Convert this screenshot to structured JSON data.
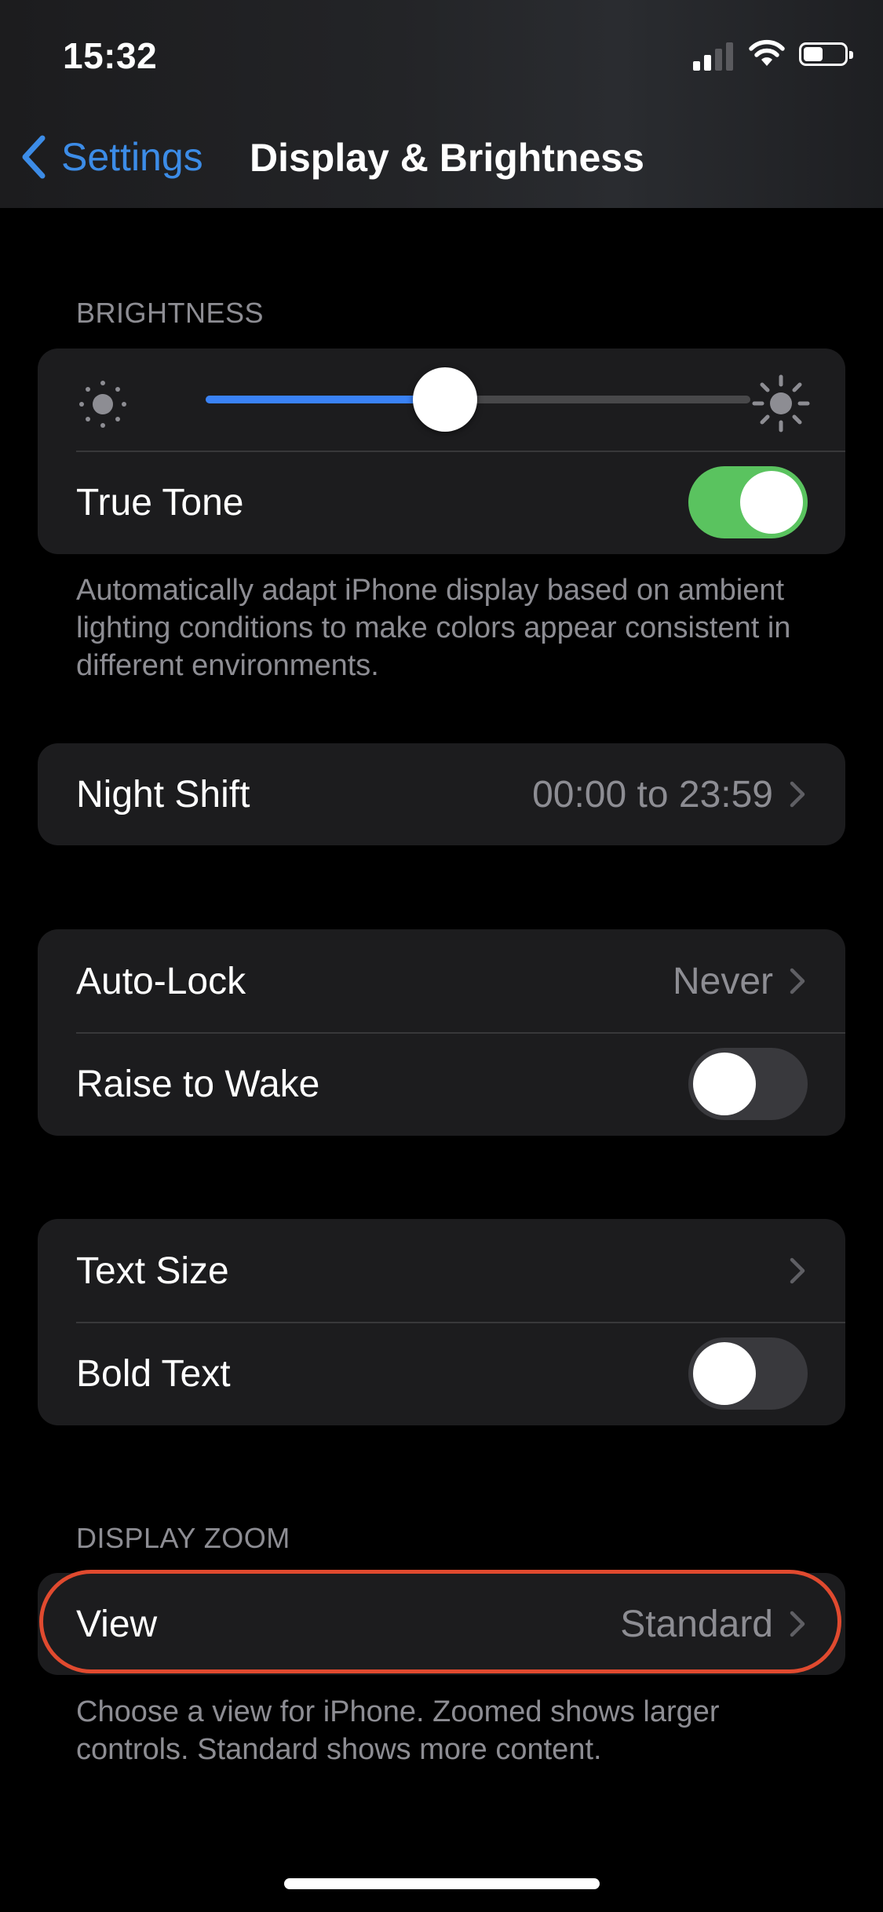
{
  "status_bar": {
    "time": "15:32"
  },
  "nav": {
    "back_label": "Settings",
    "title": "Display & Brightness"
  },
  "brightness": {
    "header": "BRIGHTNESS",
    "level": 0.44,
    "true_tone_label": "True Tone",
    "true_tone_on": true,
    "footer": "Automatically adapt iPhone display based on ambient lighting conditions to make colors appear consistent in different environments."
  },
  "night_shift": {
    "label": "Night Shift",
    "value": "00:00 to 23:59"
  },
  "lock": {
    "auto_lock_label": "Auto-Lock",
    "auto_lock_value": "Never",
    "raise_to_wake_label": "Raise to Wake",
    "raise_to_wake_on": false
  },
  "text": {
    "text_size_label": "Text Size",
    "bold_text_label": "Bold Text",
    "bold_text_on": false
  },
  "display_zoom": {
    "header": "DISPLAY ZOOM",
    "view_label": "View",
    "view_value": "Standard",
    "footer": "Choose a view for iPhone. Zoomed shows larger controls. Standard shows more content."
  },
  "colors": {
    "accent": "#3c8ce7",
    "toggle_on": "#5ac35f",
    "highlight": "#e04a2f",
    "cell_bg": "#1c1c1e"
  }
}
